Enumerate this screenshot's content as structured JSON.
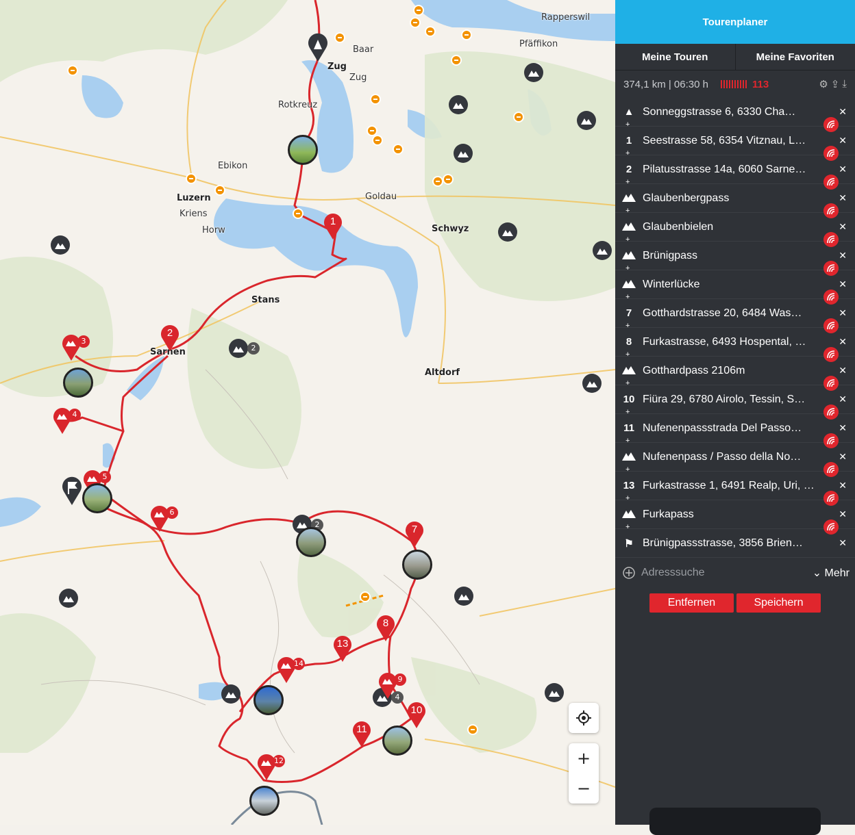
{
  "map": {
    "places": [
      {
        "name": "Rapperswil",
        "bold": false
      },
      {
        "name": "Pfäffikon",
        "bold": false
      },
      {
        "name": "Baar",
        "bold": false
      },
      {
        "name": "Zug",
        "bold": true
      },
      {
        "name": "Zug",
        "bold": false
      },
      {
        "name": "Rotkreuz",
        "bold": false
      },
      {
        "name": "Ebikon",
        "bold": false
      },
      {
        "name": "Luzern",
        "bold": true
      },
      {
        "name": "Kriens",
        "bold": false
      },
      {
        "name": "Horw",
        "bold": false
      },
      {
        "name": "Goldau",
        "bold": false
      },
      {
        "name": "Schwyz",
        "bold": true
      },
      {
        "name": "Stans",
        "bold": true
      },
      {
        "name": "Sarnen",
        "bold": true
      },
      {
        "name": "Altdorf",
        "bold": true
      }
    ],
    "pins": [
      "1",
      "2",
      "7",
      "8",
      "10",
      "11",
      "13"
    ],
    "poi_pins": [
      "3",
      "4",
      "5",
      "6",
      "9",
      "12",
      "14"
    ],
    "cluster_badges": [
      "2",
      "2",
      "4"
    ],
    "controls": {
      "locate": "locate-icon",
      "zoom_in": "+",
      "zoom_out": "−"
    }
  },
  "sidebar": {
    "title": "Tourenplaner",
    "tabs": [
      "Meine Touren",
      "Meine Favoriten"
    ],
    "stats": {
      "summary": "374,1 km | 06:30 h",
      "curviness": "113"
    },
    "waypoints": [
      {
        "index": "▲",
        "icon": "start-icon",
        "name": "Sonneggstrasse 6, 6330 Cha…"
      },
      {
        "index": "1",
        "icon": "",
        "name": "Seestrasse 58, 6354 Vitznau, L…"
      },
      {
        "index": "2",
        "icon": "",
        "name": "Pilatusstrasse 14a, 6060 Sarne…"
      },
      {
        "index": "",
        "icon": "mountain-pass-icon",
        "name": "Glaubenbergpass"
      },
      {
        "index": "",
        "icon": "mountain-pass-icon",
        "name": "Glaubenbielen"
      },
      {
        "index": "",
        "icon": "mountain-pass-icon",
        "name": "Brünigpass"
      },
      {
        "index": "",
        "icon": "mountain-pass-icon",
        "name": "Winterlücke"
      },
      {
        "index": "7",
        "icon": "",
        "name": "Gotthardstrasse 20, 6484 Was…"
      },
      {
        "index": "8",
        "icon": "",
        "name": "Furkastrasse, 6493 Hospental, …"
      },
      {
        "index": "",
        "icon": "mountain-pass-icon",
        "name": "Gotthardpass 2106m"
      },
      {
        "index": "10",
        "icon": "",
        "name": "Fiüra 29, 6780 Airolo, Tessin, S…"
      },
      {
        "index": "11",
        "icon": "",
        "name": "Nufenenpassstrada Del Passo…"
      },
      {
        "index": "",
        "icon": "mountain-pass-icon",
        "name": "Nufenenpass / Passo della No…"
      },
      {
        "index": "13",
        "icon": "",
        "name": "Furkastrasse 1, 6491 Realp, Uri, …"
      },
      {
        "index": "",
        "icon": "mountain-pass-icon",
        "name": "Furkapass"
      },
      {
        "index": "⚑",
        "icon": "finish-flag-icon",
        "name": "Brünigpassstrasse, 3856 Brien…"
      }
    ],
    "address_placeholder": "Adresssuche",
    "more_label": "Mehr",
    "remove_label": "Entfernen",
    "save_label": "Speichern"
  },
  "colors": {
    "accent": "#1fb0e6",
    "route": "#d9262c",
    "panel": "#2f3237",
    "poi": "#f39200"
  }
}
